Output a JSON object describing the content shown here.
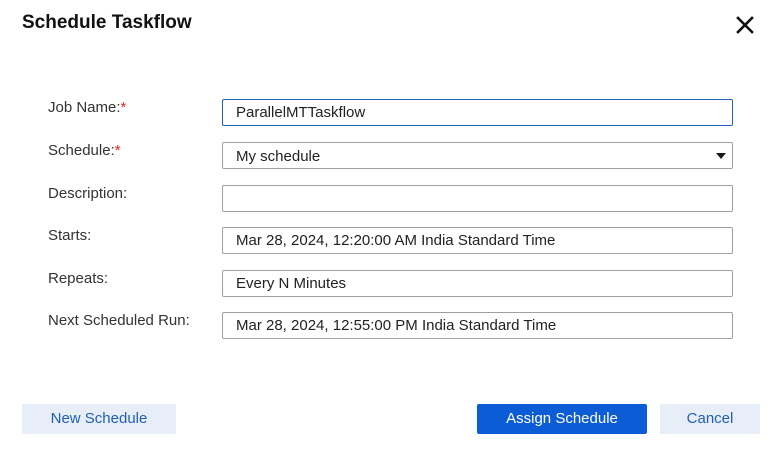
{
  "dialog": {
    "title": "Schedule Taskflow",
    "close_icon": "close-icon"
  },
  "form": {
    "job_name": {
      "label": "Job Name:",
      "required_mark": "*",
      "value": "ParallelMTTaskflow"
    },
    "schedule": {
      "label": "Schedule:",
      "required_mark": "*",
      "value": "My schedule",
      "caret_icon": "caret-down-icon"
    },
    "description": {
      "label": "Description:",
      "value": ""
    },
    "starts": {
      "label": "Starts:",
      "value": "Mar 28, 2024, 12:20:00 AM India Standard Time"
    },
    "repeats": {
      "label": "Repeats:",
      "value": "Every N Minutes"
    },
    "next_run": {
      "label": "Next Scheduled Run:",
      "value": "Mar 28, 2024, 12:55:00 PM India Standard Time"
    }
  },
  "buttons": {
    "new_schedule": "New Schedule",
    "assign_schedule": "Assign Schedule",
    "cancel": "Cancel"
  },
  "colors": {
    "primary": "#0b5cd5",
    "secondary_bg": "#e8eef8",
    "required": "#d92d20",
    "focus_border": "#1f5fb8"
  }
}
